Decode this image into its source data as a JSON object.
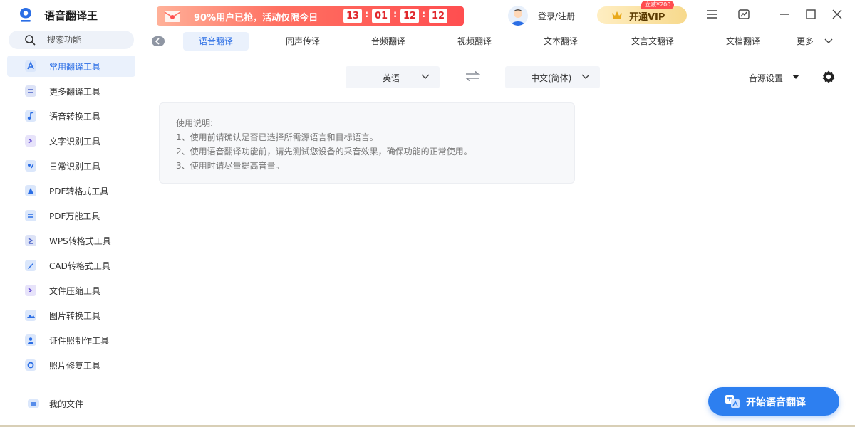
{
  "app": {
    "title": "语音翻译王",
    "accent": "#2b6ee5"
  },
  "promo": {
    "text": "90%用户已抢，活动仅限今日",
    "countdown": [
      "13",
      "01",
      "12",
      "12"
    ]
  },
  "header": {
    "login": "登录/注册",
    "vip_label": "开通VIP",
    "vip_badge": "立减¥200"
  },
  "sidebar": {
    "search_placeholder": "搜索功能",
    "items": [
      {
        "label": "常用翻译工具",
        "icon": "translate-icon",
        "active": true
      },
      {
        "label": "更多翻译工具",
        "icon": "more-translate-icon"
      },
      {
        "label": "语音转换工具",
        "icon": "music-note-icon"
      },
      {
        "label": "文字识别工具",
        "icon": "text-scan-icon"
      },
      {
        "label": "日常识别工具",
        "icon": "daily-recognize-icon"
      },
      {
        "label": "PDF转格式工具",
        "icon": "pdf-convert-icon"
      },
      {
        "label": "PDF万能工具",
        "icon": "pdf-tool-icon"
      },
      {
        "label": "WPS转格式工具",
        "icon": "wps-convert-icon"
      },
      {
        "label": "CAD转格式工具",
        "icon": "cad-convert-icon"
      },
      {
        "label": "文件压缩工具",
        "icon": "compress-icon"
      },
      {
        "label": "图片转换工具",
        "icon": "image-convert-icon"
      },
      {
        "label": "证件照制作工具",
        "icon": "id-photo-icon"
      },
      {
        "label": "照片修复工具",
        "icon": "photo-repair-icon"
      }
    ],
    "my_files": "我的文件"
  },
  "tabs": [
    {
      "label": "语音翻译",
      "active": true
    },
    {
      "label": "同声传译"
    },
    {
      "label": "音频翻译"
    },
    {
      "label": "视频翻译"
    },
    {
      "label": "文本翻译"
    },
    {
      "label": "文言文翻译"
    },
    {
      "label": "文档翻译"
    },
    {
      "label": "更多"
    }
  ],
  "languages": {
    "source": "英语",
    "target": "中文(简体)"
  },
  "toolbar": {
    "source_setting": "音源设置"
  },
  "instructions": {
    "title": "使用说明:",
    "lines": [
      "1、使用前请确认是否已选择所需源语言和目标语言。",
      "2、使用语音翻译功能前，请先测试您设备的采音效果，确保功能的正常使用。",
      "3、使用时请尽量提高音量。"
    ]
  },
  "start_button": "开始语音翻译"
}
